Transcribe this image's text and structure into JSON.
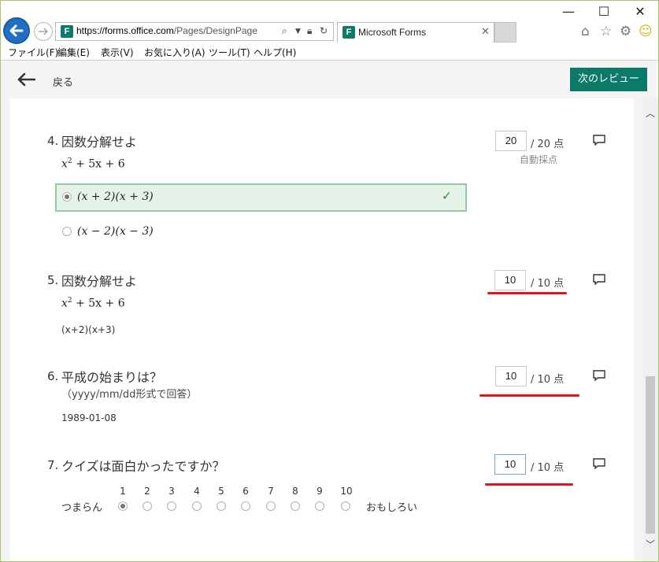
{
  "browser": {
    "url_host": "https://forms.office.com",
    "url_path": "/Pages/DesignPage.aspx",
    "tab_title": "Microsoft Forms",
    "favicon": "F",
    "menu": [
      "ファイル(F)",
      "編集(E)",
      "表示(V)",
      "お気に入り(A)",
      "ツール(T)",
      "ヘルプ(H)"
    ]
  },
  "app": {
    "back_label": "戻る",
    "next_button": "次のレビュー"
  },
  "questions": [
    {
      "num": "4.",
      "title": "因数分解せよ",
      "expr_prefix": "x",
      "expr_sup": "2",
      "expr_rest": " + 5x + 6",
      "score": "20",
      "score_max": "/ 20 点",
      "auto_label": "自動採点",
      "options": [
        "(x + 2)(x + 3)",
        "(x − 2)(x − 3)"
      ],
      "check_mark": "✓"
    },
    {
      "num": "5.",
      "title": "因数分解せよ",
      "expr_prefix": "x",
      "expr_sup": "2",
      "expr_rest": " + 5x + 6",
      "answer": "(x+2)(x+3)",
      "score": "10",
      "score_max": "/ 10 点"
    },
    {
      "num": "6.",
      "title": "平成の始まりは？",
      "subtitle": "（yyyy/mm/dd形式で回答）",
      "answer": "1989-01-08",
      "score": "10",
      "score_max": "/ 10 点"
    },
    {
      "num": "7.",
      "title": "クイズは面白かったですか？",
      "score": "10",
      "score_max": "/ 10 点",
      "scale": [
        "1",
        "2",
        "3",
        "4",
        "5",
        "6",
        "7",
        "8",
        "9",
        "10"
      ],
      "scale_selected": 1,
      "left_label": "つまらん",
      "right_label": "おもしろい"
    }
  ],
  "colors": {
    "accent": "#0b7a68",
    "correct_bg": "#e6f3e8",
    "correct_border": "#90cc9f",
    "annotation": "#e0161e"
  }
}
